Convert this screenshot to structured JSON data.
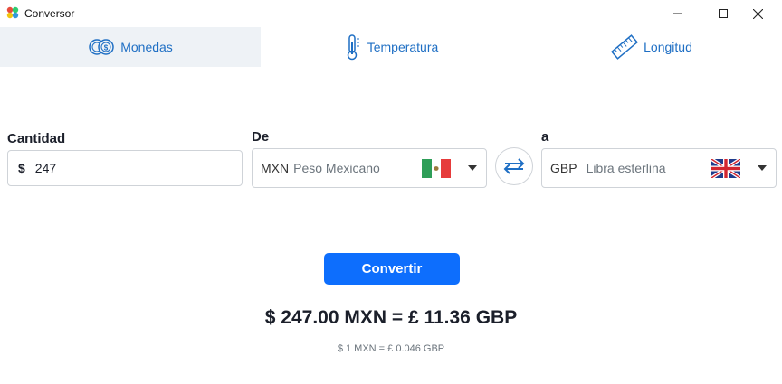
{
  "window": {
    "title": "Conversor"
  },
  "tabs": [
    {
      "label": "Monedas",
      "icon": "coins-icon",
      "active": true
    },
    {
      "label": "Temperatura",
      "icon": "thermometer-icon",
      "active": false
    },
    {
      "label": "Longitud",
      "icon": "ruler-icon",
      "active": false
    }
  ],
  "form": {
    "amount_label": "Cantidad",
    "amount_symbol": "$",
    "amount_value": "247",
    "from_label": "De",
    "from_code": "MXN",
    "from_name": "Peso Mexicano",
    "from_flag": "mexico-flag-icon",
    "to_label": "a",
    "to_code": "GBP",
    "to_name": "Libra esterlina",
    "to_flag": "uk-flag-icon"
  },
  "convert_label": "Convertir",
  "result": {
    "text": "$ 247.00 MXN = £ 11.36 GBP",
    "rate_text": "$ 1 MXN = £ 0.046 GBP"
  },
  "colors": {
    "accent": "#0d6efd",
    "tab_text": "#1f6fc4",
    "active_tab_bg": "#eef2f6"
  }
}
